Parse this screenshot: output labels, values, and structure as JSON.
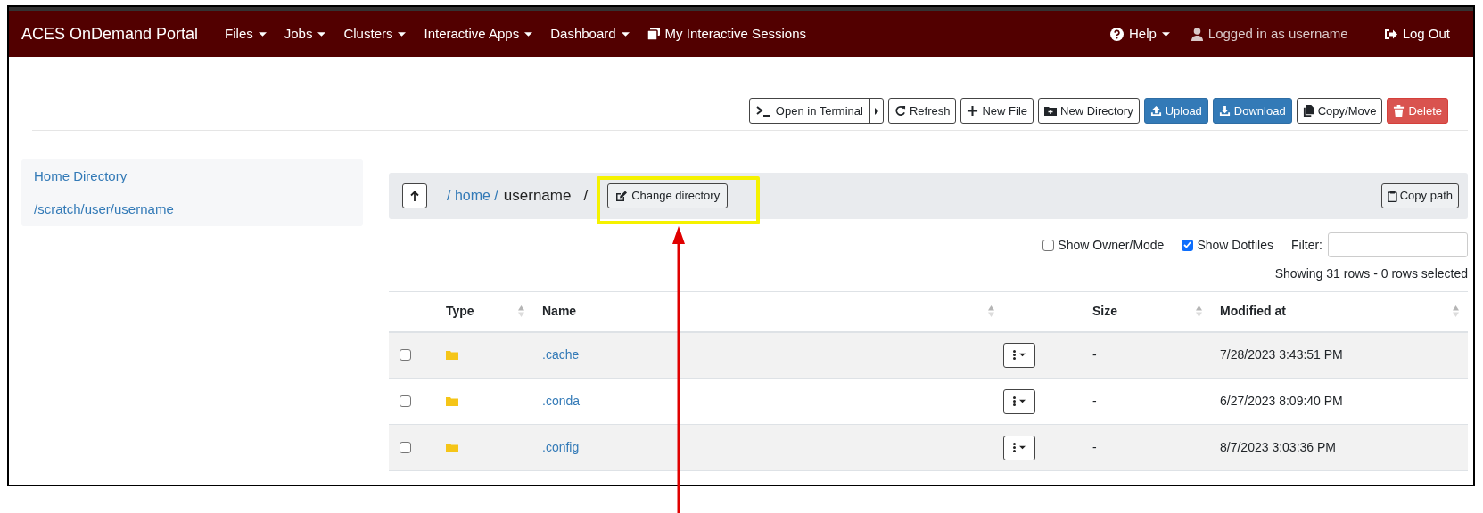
{
  "navbar": {
    "brand": "ACES OnDemand Portal",
    "menus": [
      {
        "kind": "dropdown",
        "label": "Files"
      },
      {
        "kind": "dropdown",
        "label": "Jobs"
      },
      {
        "kind": "dropdown",
        "label": "Clusters"
      },
      {
        "kind": "dropdown",
        "label": "Interactive Apps"
      },
      {
        "kind": "dropdown",
        "label": "Dashboard"
      },
      {
        "kind": "sessions",
        "label": "My Interactive Sessions"
      }
    ],
    "right": [
      {
        "kind": "help",
        "label": "Help"
      },
      {
        "kind": "user",
        "label": "Logged in as username"
      },
      {
        "kind": "logout",
        "label": "Log Out"
      }
    ]
  },
  "toolbar": [
    {
      "kind": "terminal",
      "label": "Open in Terminal"
    },
    {
      "kind": "refresh",
      "label": "Refresh"
    },
    {
      "kind": "new-file",
      "label": "New File"
    },
    {
      "kind": "new-folder",
      "label": "New Directory"
    },
    {
      "kind": "upload",
      "label": "Upload"
    },
    {
      "kind": "download",
      "label": "Download"
    },
    {
      "kind": "copy",
      "label": "Copy/Move"
    },
    {
      "kind": "delete",
      "label": "Delete"
    }
  ],
  "sidebar": {
    "items": [
      "Home Directory",
      "/scratch/user/username"
    ]
  },
  "breadcrumb": {
    "links": [
      "/ home /"
    ],
    "current": "username",
    "trailing": "/",
    "change_button": "Change directory",
    "copy_button": "Copy path"
  },
  "options": [
    {
      "label": "Show Owner/Mode",
      "checked": false
    },
    {
      "label": "Show Dotfiles",
      "checked": true
    }
  ],
  "filter": {
    "label": "Filter:"
  },
  "summary": "Showing 31 rows - 0 rows selected",
  "table": {
    "columns": [
      "Type",
      "Name",
      "Size",
      "Modified at"
    ],
    "rows": [
      {
        "checked": false,
        "name": ".cache",
        "size": "-",
        "modified": "7/28/2023 3:43:51 PM"
      },
      {
        "checked": false,
        "name": ".conda",
        "size": "-",
        "modified": "6/27/2023 8:09:40 PM"
      },
      {
        "checked": false,
        "name": ".config",
        "size": "-",
        "modified": "8/7/2023 3:03:36 PM"
      }
    ]
  }
}
